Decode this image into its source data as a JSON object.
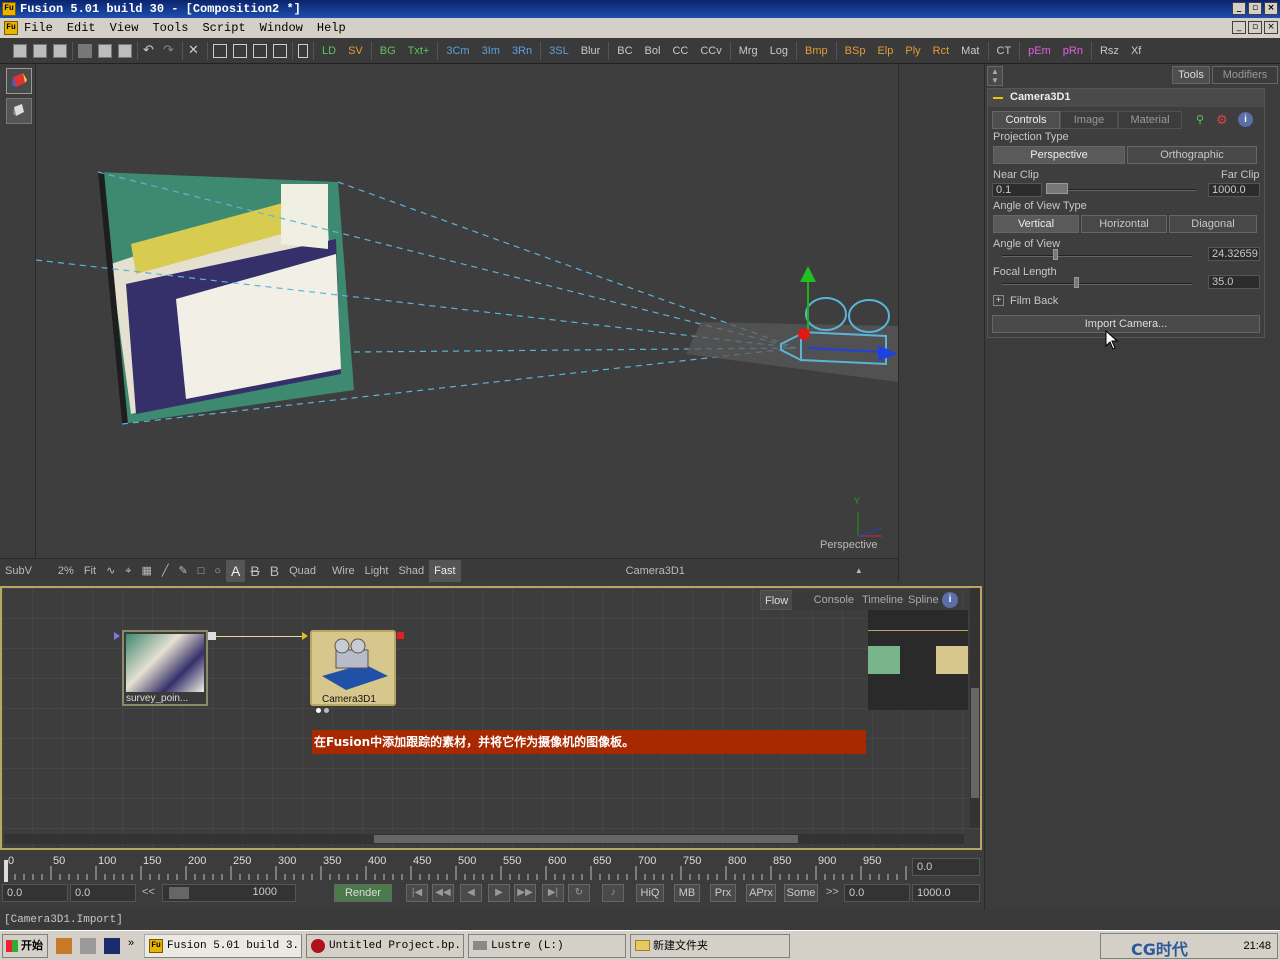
{
  "window": {
    "title": "Fusion 5.01 build 30 - [Composition2 *]",
    "app_badge": "Fu"
  },
  "menu": [
    "File",
    "Edit",
    "View",
    "Tools",
    "Script",
    "Window",
    "Help"
  ],
  "toolbar": {
    "tools": [
      {
        "label": "LD",
        "color": "g"
      },
      {
        "label": "SV",
        "color": "o"
      },
      {
        "label": "BG",
        "color": "g"
      },
      {
        "label": "Txt+",
        "color": "g"
      },
      {
        "label": "3Cm",
        "color": "b"
      },
      {
        "label": "3Im",
        "color": "b"
      },
      {
        "label": "3Rn",
        "color": "b"
      },
      {
        "label": "3SL",
        "color": "b"
      },
      {
        "label": "Blur",
        "color": ""
      },
      {
        "label": "BC",
        "color": ""
      },
      {
        "label": "Bol",
        "color": ""
      },
      {
        "label": "CC",
        "color": ""
      },
      {
        "label": "CCv",
        "color": ""
      },
      {
        "label": "Mrg",
        "color": ""
      },
      {
        "label": "Log",
        "color": ""
      },
      {
        "label": "Bmp",
        "color": "o"
      },
      {
        "label": "BSp",
        "color": "o"
      },
      {
        "label": "Elp",
        "color": "o"
      },
      {
        "label": "Ply",
        "color": "o"
      },
      {
        "label": "Rct",
        "color": "o"
      },
      {
        "label": "Mat",
        "color": ""
      },
      {
        "label": "CT",
        "color": ""
      },
      {
        "label": "pEm",
        "color": "m"
      },
      {
        "label": "pRn",
        "color": "m"
      },
      {
        "label": "Rsz",
        "color": ""
      },
      {
        "label": "Xf",
        "color": ""
      }
    ]
  },
  "viewport": {
    "view_label": "Perspective",
    "axis_y": "Y"
  },
  "viewbar": {
    "subv": "SubV",
    "zoom": "2%",
    "fit": "Fit",
    "quad": "Quad",
    "wire": "Wire",
    "light": "Light",
    "shad": "Shad",
    "fast": "Fast",
    "node_name": "Camera3D1",
    "letters": [
      "A",
      "B",
      "B"
    ]
  },
  "flow": {
    "tabs": [
      "Flow",
      "Console",
      "Timeline",
      "Spline"
    ],
    "nodes": [
      {
        "label": "survey_poin..."
      },
      {
        "label": "Camera3D1"
      }
    ],
    "caption": "在Fusion中添加跟踪的素材，并将它作为摄像机的图像板。"
  },
  "timeline": {
    "ticks": [
      "0",
      "50",
      "100",
      "150",
      "200",
      "250",
      "300",
      "350",
      "400",
      "450",
      "500",
      "550",
      "600",
      "650",
      "700",
      "750",
      "800",
      "850",
      "900",
      "950"
    ],
    "current": "0.0",
    "start": "0.0",
    "render_start": "0.0",
    "range_end": "1000",
    "render_label": "Render",
    "buttons": [
      "HiQ",
      "MB",
      "Prx",
      "APrx",
      "Some"
    ],
    "end_start": "0.0",
    "end_value": "1000.0",
    "more": ">>",
    "less": "<<"
  },
  "panel": {
    "tabs": [
      "Tools",
      "Modifiers"
    ],
    "tool_name": "Camera3D1",
    "subtabs": [
      "Controls",
      "Image",
      "Material"
    ],
    "projection_type_label": "Projection Type",
    "projection": [
      "Perspective",
      "Orthographic"
    ],
    "near_clip_label": "Near Clip",
    "near_clip": "0.1",
    "far_clip_label": "Far Clip",
    "far_clip": "1000.0",
    "aov_type_label": "Angle of View Type",
    "aov_types": [
      "Vertical",
      "Horizontal",
      "Diagonal"
    ],
    "aov_label": "Angle of View",
    "aov": "24.32659",
    "focal_label": "Focal Length",
    "focal": "35.0",
    "film_back": "Film Back",
    "import_camera": "Import Camera..."
  },
  "status": "[Camera3D1.Import]",
  "taskbar": {
    "start": "开始",
    "items": [
      "Fusion 5.01 build 3...",
      "Untitled Project.bp...",
      "Lustre  (L:)",
      "新建文件夹"
    ],
    "watermark": "CG时代",
    "clock": "21:48"
  },
  "colors": {
    "accent": "#b9a660",
    "flow_caption_bg": "#a82800",
    "caption_text": "#ffffff",
    "title_bg": "#0a246a"
  }
}
